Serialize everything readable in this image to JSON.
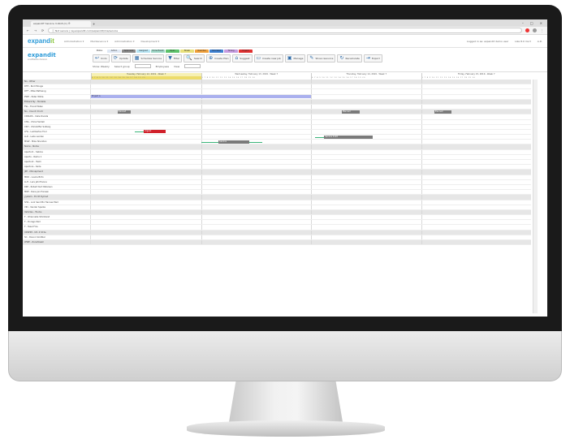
{
  "browser": {
    "tab_title": "expandIT Service 3.00.8 (C) ®",
    "new_tab": "+",
    "url": "ⓘ Not secure | ray.expandit.com/expandit/ims/service",
    "window_controls": [
      "–",
      "□",
      "×"
    ]
  },
  "app": {
    "logo_main": "expand",
    "logo_accent": "it",
    "menu": [
      "Administration ▾",
      "Maintenance ▾",
      "Administration ▾",
      "Development ▾"
    ],
    "user": [
      "Logged in as: expandit demo user",
      "Like 8.0 ms ▾",
      "A.D."
    ]
  },
  "ribbon": {
    "logo": "expandit",
    "logo_sub": "a software division",
    "tabs": [
      {
        "label": "Status",
        "color": "#ffffff"
      },
      {
        "label": "Action",
        "color": "#dfe8f4"
      },
      {
        "label": "Approved",
        "color": "#8a8a8a"
      },
      {
        "label": "Assigned",
        "color": "#b5e3f2"
      },
      {
        "label": "Done Event",
        "color": "#9fd8c8"
      },
      {
        "label": "Open",
        "color": "#5cc26a"
      },
      {
        "label": "Break",
        "color": "#e8e07a"
      },
      {
        "label": "Overdue",
        "color": "#f0a03a"
      },
      {
        "label": "Canceled",
        "color": "#3c7fd0"
      },
      {
        "label": "Timing",
        "color": "#c59be0"
      },
      {
        "label": "Urgent",
        "color": "#e03030"
      }
    ],
    "buttons": [
      {
        "icon": "↩",
        "label": "Undo"
      },
      {
        "icon": "⟳",
        "label": "Update"
      },
      {
        "icon": "▦",
        "label": "Schedule Service"
      },
      {
        "icon": "▼",
        "label": "Filter"
      },
      {
        "icon": "🔍",
        "label": "Search"
      },
      {
        "icon": "⊕",
        "label": "Create Plan"
      },
      {
        "icon": "⌂",
        "label": "Suggest"
      },
      {
        "icon": "▭",
        "label": "Create new job"
      },
      {
        "icon": "▣",
        "label": "Manage"
      },
      {
        "icon": "✎",
        "label": "Show resource"
      },
      {
        "icon": "↻",
        "label": "Recalculate"
      },
      {
        "icon": "⇥",
        "label": "Export"
      }
    ],
    "row2": [
      "Show: Weekly",
      "Select group",
      "Employees",
      "View"
    ]
  },
  "schedule": {
    "days": [
      {
        "label": "Tuesday, February 12, 2019 - Week 7",
        "highlight": true
      },
      {
        "label": "Wednesday, February 13, 2019 - Week 7",
        "highlight": false
      },
      {
        "label": "Thursday, February 14, 2019 - Week 7",
        "highlight": false
      },
      {
        "label": "Friday, February 15, 2019 - Week 7",
        "highlight": false
      }
    ],
    "hours": "6 7 8 9 10 11 12 13 14 15 16 17 18 19 20",
    "rows": [
      {
        "label": "No - Other",
        "group": true
      },
      {
        "label": "DTP - Rudi Mouga",
        "group": false
      },
      {
        "label": "DTF - Mike Matheing",
        "group": false
      },
      {
        "label": "PWH - Peter Wilde",
        "group": false
      },
      {
        "label": "ECbark Ny - Modelle",
        "group": true
      },
      {
        "label": "FSL - Frank Elsten",
        "group": false
      },
      {
        "label": "No - Countr D Ltd",
        "group": true
      },
      {
        "label": "CDRLRS - Calle Rivada",
        "group": false
      },
      {
        "label": "CHA - Chris Hadrall",
        "group": false
      },
      {
        "label": "CSH - Christoffer Solberg",
        "group": false
      },
      {
        "label": "LFG - Lambertus Fool",
        "group": false
      },
      {
        "label": "LLD - Lade Lenden",
        "group": false
      },
      {
        "label": "MSW - Mike Sheridan",
        "group": false
      },
      {
        "label": "Nome - Nome",
        "group": true
      },
      {
        "label": "Apertur1 - Sabine",
        "group": false
      },
      {
        "label": "Apertu - Rame 1",
        "group": false
      },
      {
        "label": "Apertur2 - Helm",
        "group": false
      },
      {
        "label": "Aperture - Kade",
        "group": false
      },
      {
        "label": "JPP - Minnapment",
        "group": true
      },
      {
        "label": "MRO - Laurie Brito",
        "group": false
      },
      {
        "label": "LLH - Lars Jahl Hanna",
        "group": false
      },
      {
        "label": "RKP - Robert Kurt Petersen",
        "group": false
      },
      {
        "label": "MRP - Rune Jan Hansen",
        "group": false
      },
      {
        "label": "yystem - Ex Ot Dymed",
        "group": true
      },
      {
        "label": "SHA - Lool Sand Bo Hannes Med",
        "group": false
      },
      {
        "label": "VID - Vander Sparke",
        "group": false
      },
      {
        "label": "Vehicles - Trucks",
        "group": true
      },
      {
        "label": "T - Ohannelle Strickland",
        "group": false
      },
      {
        "label": "T - Dorago Nad",
        "group": false
      },
      {
        "label": "T - Tesel Fros",
        "group": false
      },
      {
        "label": "UDSHM - Ult. 4 St lle",
        "group": true
      },
      {
        "label": "SC - Devon Sindbler",
        "group": false
      },
      {
        "label": "WWE - Zunahlsast",
        "group": true
      }
    ],
    "bars": [
      {
        "row": 3,
        "start": 0.0,
        "end": 0.5,
        "color": "#aab0ee",
        "label": "Project A"
      },
      {
        "row": 6,
        "start": 0.06,
        "end": 0.09,
        "color": "#7a7a7a",
        "label": "Planned"
      },
      {
        "row": 6,
        "start": 0.57,
        "end": 0.61,
        "color": "#7a7a7a",
        "label": "Planned"
      },
      {
        "row": 6,
        "start": 0.78,
        "end": 0.82,
        "color": "#7a7a7a",
        "label": "Planned"
      },
      {
        "row": 10,
        "start": 0.12,
        "end": 0.17,
        "color": "#d0202a",
        "label": "Urgent"
      },
      {
        "row": 11,
        "start": 0.53,
        "end": 0.64,
        "color": "#7a7a7a",
        "label": "Service 4103"
      },
      {
        "row": 12,
        "start": 0.29,
        "end": 0.36,
        "color": "#7a7a7a",
        "label": "Service"
      }
    ],
    "tails": [
      {
        "row": 10,
        "start": 0.1,
        "end": 0.12
      },
      {
        "row": 11,
        "start": 0.51,
        "end": 0.53
      },
      {
        "row": 12,
        "start": 0.25,
        "end": 0.29
      },
      {
        "row": 12,
        "start": 0.36,
        "end": 0.39
      }
    ]
  }
}
